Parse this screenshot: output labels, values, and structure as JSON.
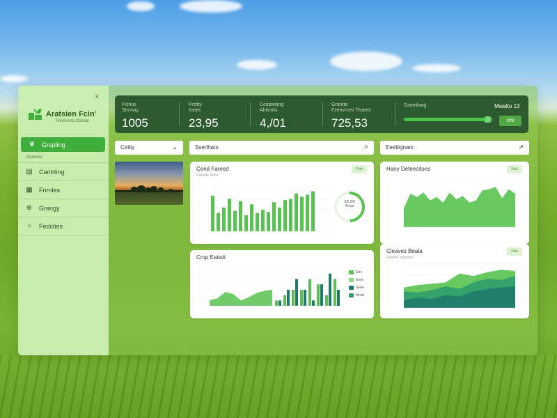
{
  "app": {
    "title": "Aratsien Fcin'",
    "subtitle": "Fnnmerrts Dnscat",
    "close_glyph": "×"
  },
  "sidebar": {
    "items": [
      {
        "label": "Grspling",
        "icon": "leaf-icon",
        "glyph": "❦",
        "active": true
      },
      {
        "label": "Cantrting",
        "icon": "grid-icon",
        "glyph": "▤",
        "active": false
      },
      {
        "label": "Fnrnles",
        "icon": "farm-icon",
        "glyph": "▦",
        "active": false
      },
      {
        "label": "Grangy",
        "icon": "globe-icon",
        "glyph": "⊕",
        "active": false
      },
      {
        "label": "Fedcties",
        "icon": "settings-icon",
        "glyph": "○",
        "active": false
      }
    ],
    "sub_label": "Gsrtrnes"
  },
  "stats": [
    {
      "label": "Fcihus\nStrnnay",
      "value": "1005"
    },
    {
      "label": "Frzitty\nInnes",
      "value": "23,95"
    },
    {
      "label": "Ccopwxing\nAhtirsrts",
      "value": "4,/01"
    },
    {
      "label": "Grsrute\nFzenvrces Tlsaets",
      "value": "725,53"
    }
  ],
  "progress": {
    "label": "Gsmrtlang",
    "value_fraction": 0.96,
    "date": "Mwalto 13",
    "button_label": "Stfill"
  },
  "toolbar": {
    "select_value": "Cetliy",
    "select_chevron": "⌄",
    "search_placeholder": "Sserlhars",
    "search_icon": "⌕",
    "filter_value": "Eeetlignars",
    "filter_icon": "↗"
  },
  "cards": {
    "c1": {
      "title": "Cend Fareed",
      "subtitle": "Faelrsts shrhs",
      "badge": "Fish",
      "donut_label": "3/6 5/0\nAn'sa"
    },
    "c2": {
      "title": "Hany Deteecitoes",
      "subtitle": "",
      "badge": "Fish"
    },
    "c3": {
      "title": "Crop Eatsdi",
      "subtitle": "",
      "legend": [
        "Etrs",
        "Eiets",
        "Glaw",
        "Mrasl"
      ]
    },
    "c4": {
      "title": "Cleaves Beala",
      "subtitle": "Farhem Sraciaas",
      "badge": "Fish"
    }
  },
  "chart_data": [
    {
      "type": "bar",
      "title": "Cend Fareed",
      "values": [
        6.6,
        3.4,
        4.4,
        6.0,
        3.8,
        5.6,
        3.0,
        5.0,
        3.4,
        4.0,
        3.6,
        5.4,
        4.4,
        5.8,
        6.0,
        7.0,
        6.4,
        6.8,
        7.4
      ]
    },
    {
      "type": "area",
      "title": "Hany Deteecitoes",
      "values": [
        3.4,
        6.0,
        5.4,
        6.2,
        4.8,
        5.4,
        4.4,
        6.2,
        5.0,
        5.6,
        4.4,
        4.8,
        6.6,
        6.8,
        7.2,
        5.2,
        6.8,
        6.0
      ]
    },
    {
      "type": "bar",
      "title": "Crop Eatsdi",
      "series": [
        {
          "name": "Etrs",
          "values": [
            1,
            2,
            3,
            3,
            5,
            4,
            2,
            5,
            3,
            6
          ]
        },
        {
          "name": "Glaw",
          "values": [
            1,
            3,
            5,
            3,
            1,
            4,
            6,
            3,
            2,
            4
          ]
        }
      ],
      "area": [
        1.0,
        1.4,
        2.6,
        2.2,
        1.0,
        1.6,
        2.4,
        2.8,
        3.0
      ]
    },
    {
      "type": "area",
      "title": "Cleaves Beala",
      "series": [
        {
          "name": "s1",
          "values": [
            3.2,
            3.6,
            3.8,
            4.0,
            5.4,
            5.0,
            5.6,
            6.0,
            5.8
          ]
        },
        {
          "name": "s2",
          "values": [
            2.6,
            2.4,
            2.8,
            3.4,
            3.0,
            4.0,
            4.6,
            4.4,
            5.0
          ]
        },
        {
          "name": "s3",
          "values": [
            1.2,
            1.6,
            1.4,
            2.0,
            1.8,
            2.6,
            3.0,
            3.2,
            3.4
          ]
        }
      ]
    }
  ],
  "colors": {
    "accent": "#3fae3a",
    "stats_bg": "#2d5a2e",
    "bar": "#57c34e",
    "bar_dark": "#1f7a6b"
  }
}
